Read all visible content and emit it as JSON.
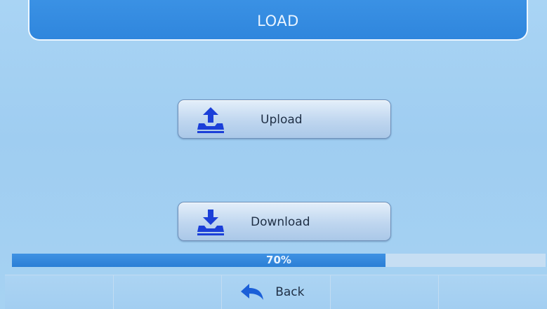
{
  "header": {
    "title": "LOAD"
  },
  "actions": {
    "upload": {
      "label": "Upload",
      "icon": "upload-tray-icon"
    },
    "download": {
      "label": "Download",
      "icon": "download-tray-icon"
    }
  },
  "progress": {
    "percent": 70,
    "label": "70%"
  },
  "bottom_bar": {
    "back": {
      "label": "Back",
      "icon": "back-arrow-icon"
    }
  },
  "colors": {
    "accent": "#2f86dd",
    "background": "#a9d4f4",
    "icon_blue": "#1b3fd8"
  }
}
